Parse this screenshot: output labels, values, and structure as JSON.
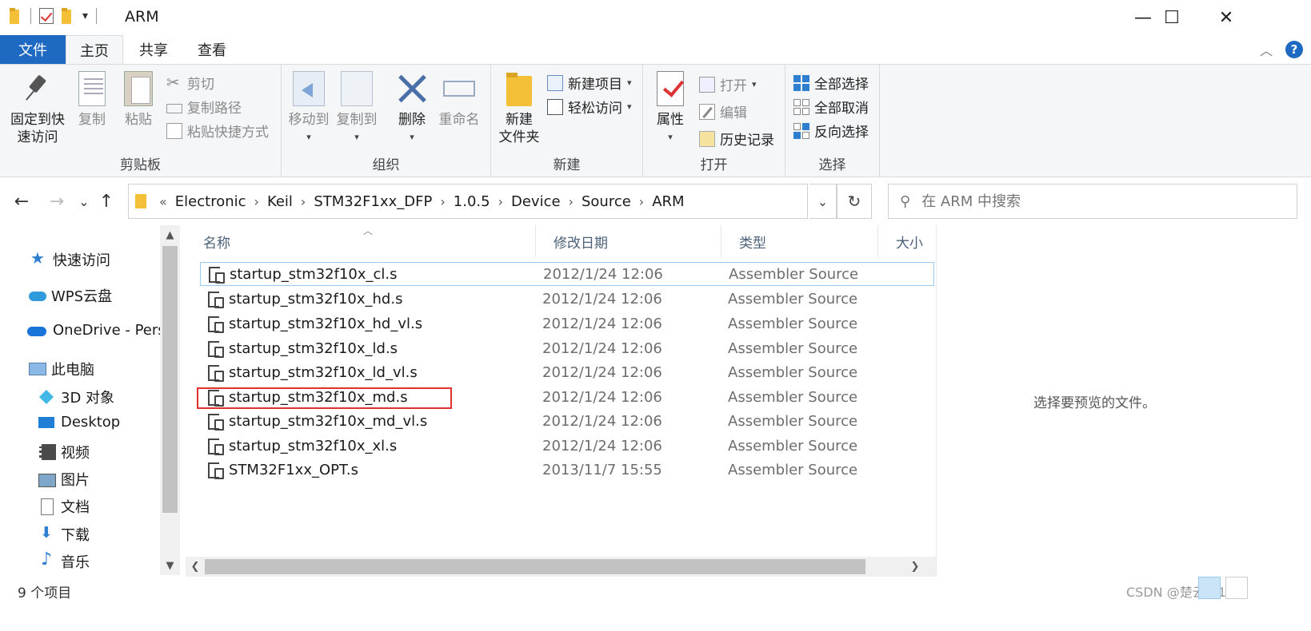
{
  "window": {
    "title": "ARM",
    "minimize": "—",
    "maximize": "☐",
    "close": "✕"
  },
  "quick_access": {
    "customize": "▾"
  },
  "ribbon_tabs": [
    "文件",
    "主页",
    "共享",
    "查看"
  ],
  "ribbon": {
    "clipboard": {
      "label": "剪贴板",
      "pin": "固定到快\n速访问",
      "copy": "复制",
      "paste": "粘贴",
      "cut": "剪切",
      "copy_path": "复制路径",
      "paste_shortcut": "粘贴快捷方式"
    },
    "organize": {
      "label": "组织",
      "move_to": "移动到",
      "copy_to": "复制到",
      "delete": "删除",
      "rename": "重命名"
    },
    "new": {
      "label": "新建",
      "new_folder": "新建\n文件夹",
      "new_item": "新建项目",
      "easy_access": "轻松访问"
    },
    "open": {
      "label": "打开",
      "properties": "属性",
      "open": "打开",
      "edit": "编辑",
      "history": "历史记录"
    },
    "select": {
      "label": "选择",
      "select_all": "全部选择",
      "select_none": "全部取消",
      "invert": "反向选择"
    }
  },
  "nav": {
    "back": "←",
    "forward": "→",
    "recent": "⌄",
    "up": "↑",
    "breadcrumb": [
      "Electronic",
      "Keil",
      "STM32F1xx_DFP",
      "1.0.5",
      "Device",
      "Source",
      "ARM"
    ],
    "overflow": "«",
    "refresh": "↻",
    "search_placeholder": "在 ARM 中搜索"
  },
  "nav_pane": [
    {
      "label": "快速访问",
      "icon": "star-icon"
    },
    {
      "label": "WPS云盘",
      "icon": "cloud-icon"
    },
    {
      "label": "OneDrive - Persc",
      "icon": "onedrive-icon"
    },
    {
      "label": "此电脑",
      "icon": "computer-icon"
    },
    {
      "label": "3D 对象",
      "icon": "cube-icon"
    },
    {
      "label": "Desktop",
      "icon": "desktop-icon"
    },
    {
      "label": "视频",
      "icon": "video-icon"
    },
    {
      "label": "图片",
      "icon": "pictures-icon"
    },
    {
      "label": "文档",
      "icon": "documents-icon"
    },
    {
      "label": "下载",
      "icon": "download-icon"
    },
    {
      "label": "音乐",
      "icon": "music-icon"
    }
  ],
  "columns": [
    "名称",
    "修改日期",
    "类型",
    "大小"
  ],
  "files": [
    {
      "name": "startup_stm32f10x_cl.s",
      "date": "2012/1/24 12:06",
      "type": "Assembler Source"
    },
    {
      "name": "startup_stm32f10x_hd.s",
      "date": "2012/1/24 12:06",
      "type": "Assembler Source"
    },
    {
      "name": "startup_stm32f10x_hd_vl.s",
      "date": "2012/1/24 12:06",
      "type": "Assembler Source"
    },
    {
      "name": "startup_stm32f10x_ld.s",
      "date": "2012/1/24 12:06",
      "type": "Assembler Source"
    },
    {
      "name": "startup_stm32f10x_ld_vl.s",
      "date": "2012/1/24 12:06",
      "type": "Assembler Source"
    },
    {
      "name": "startup_stm32f10x_md.s",
      "date": "2012/1/24 12:06",
      "type": "Assembler Source"
    },
    {
      "name": "startup_stm32f10x_md_vl.s",
      "date": "2012/1/24 12:06",
      "type": "Assembler Source"
    },
    {
      "name": "startup_stm32f10x_xl.s",
      "date": "2012/1/24 12:06",
      "type": "Assembler Source"
    },
    {
      "name": "STM32F1xx_OPT.s",
      "date": "2013/11/7 15:55",
      "type": "Assembler Source"
    }
  ],
  "preview": {
    "text": "选择要预览的文件。"
  },
  "status": {
    "count": "9 个项目",
    "watermark": "CSDN @楚云霄123"
  },
  "colors": {
    "file_tab": "#1e6ac2",
    "highlight_box": "#e0312e",
    "focus_border": "#99c9ef"
  }
}
